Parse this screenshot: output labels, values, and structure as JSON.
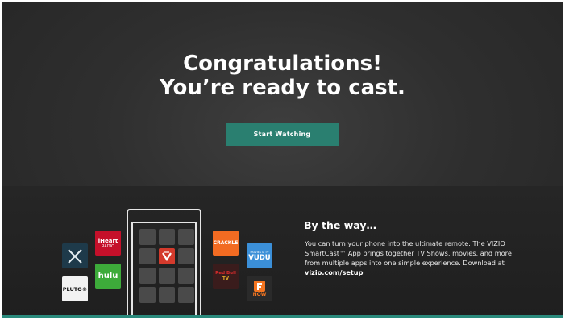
{
  "headline": {
    "line1": "Congratulations!",
    "line2": "You’re ready to cast."
  },
  "start_button": {
    "label": "Start Watching"
  },
  "by_the_way": {
    "title": "By the way…",
    "body": "You can turn your phone into the ultimate remote. The VIZIO SmartCast™ App brings together TV Shows, movies, and more from multiple apps into one simple experience. Download at ",
    "link": "vizio.com/setup"
  },
  "apps": {
    "iheart": {
      "line1": "iHeart",
      "line2": "RADIO"
    },
    "hulu": "hulu",
    "pluto": "PLUTO®",
    "crackle": "CRACKLE",
    "vudu": {
      "small": "MOVIES & TV",
      "name": "VUDU"
    },
    "redbull": {
      "line1": "Red Bull",
      "line2": "TV"
    },
    "fandango": "NOW"
  },
  "colors": {
    "accent": "#2a7f70",
    "vizio_tile": "#d43a2c",
    "iheart": "#c5102a",
    "hulu": "#3dab3a",
    "crackle": "#f26b22",
    "vudu": "#3b8fd8",
    "fandango": "#f47521"
  },
  "icons": [
    "x-app-icon",
    "iheart-radio-icon",
    "hulu-icon",
    "pluto-tv-icon",
    "vizio-v-icon",
    "crackle-icon",
    "vudu-icon",
    "red-bull-tv-icon",
    "fandango-now-icon"
  ]
}
